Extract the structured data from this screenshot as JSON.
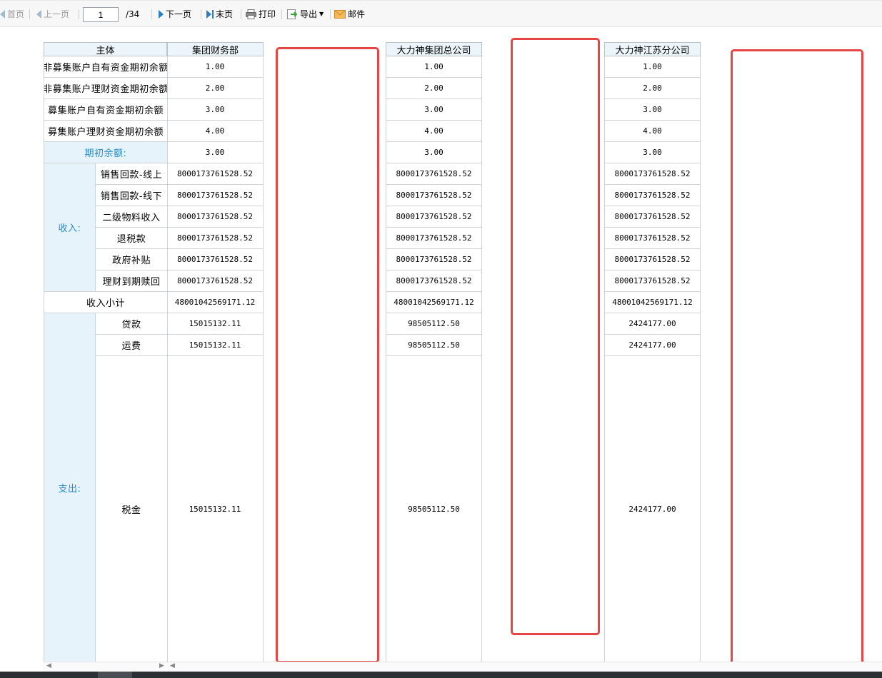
{
  "toolbar": {
    "first_label": "首页",
    "prev_label": "上一页",
    "page_value": "1",
    "page_total": "/34",
    "next_label": "下一页",
    "last_label": "末页",
    "print_label": "打印",
    "export_label": "导出",
    "mail_label": "邮件"
  },
  "table": {
    "header_subject": "主体",
    "columns": [
      "集团财务部",
      "大力神集团总公司",
      "大力神江苏分公司"
    ],
    "rows": {
      "r1": {
        "label": "非募集账户自有资金期初余额",
        "values": [
          "1.00",
          "1.00",
          "1.00"
        ]
      },
      "r2": {
        "label": "非募集账户理财资金期初余额",
        "values": [
          "2.00",
          "2.00",
          "2.00"
        ]
      },
      "r3": {
        "label": "募集账户自有资金期初余额",
        "values": [
          "3.00",
          "3.00",
          "3.00"
        ]
      },
      "r4": {
        "label": "募集账户理财资金期初余额",
        "values": [
          "4.00",
          "4.00",
          "4.00"
        ]
      },
      "opening": {
        "label": "期初余额:",
        "values": [
          "3.00",
          "3.00",
          "3.00"
        ]
      }
    },
    "income": {
      "group_label": "收入:",
      "items": [
        {
          "label": "销售回款-线上",
          "values": [
            "8000173761528.52",
            "8000173761528.52",
            "8000173761528.52"
          ]
        },
        {
          "label": "销售回款-线下",
          "values": [
            "8000173761528.52",
            "8000173761528.52",
            "8000173761528.52"
          ]
        },
        {
          "label": "二级物料收入",
          "values": [
            "8000173761528.52",
            "8000173761528.52",
            "8000173761528.52"
          ]
        },
        {
          "label": "退税款",
          "values": [
            "8000173761528.52",
            "8000173761528.52",
            "8000173761528.52"
          ]
        },
        {
          "label": "政府补贴",
          "values": [
            "8000173761528.52",
            "8000173761528.52",
            "8000173761528.52"
          ]
        },
        {
          "label": "理财到期赎回",
          "values": [
            "8000173761528.52",
            "8000173761528.52",
            "8000173761528.52"
          ]
        }
      ],
      "subtotal": {
        "label": "收入小计",
        "values": [
          "48001042569171.12",
          "48001042569171.12",
          "48001042569171.12"
        ]
      }
    },
    "expense": {
      "group_label": "支出:",
      "items": [
        {
          "label": "贷款",
          "values": [
            "15015132.11",
            "98505112.50",
            "2424177.00"
          ]
        },
        {
          "label": "运费",
          "values": [
            "15015132.11",
            "98505112.50",
            "2424177.00"
          ]
        },
        {
          "label": "税金",
          "values": [
            "15015132.11",
            "98505112.50",
            "2424177.00"
          ]
        }
      ]
    }
  },
  "colors": {
    "highlight": "#e64545",
    "accent_blue": "#2a8ac8",
    "header_bg": "#ecf5fa"
  }
}
